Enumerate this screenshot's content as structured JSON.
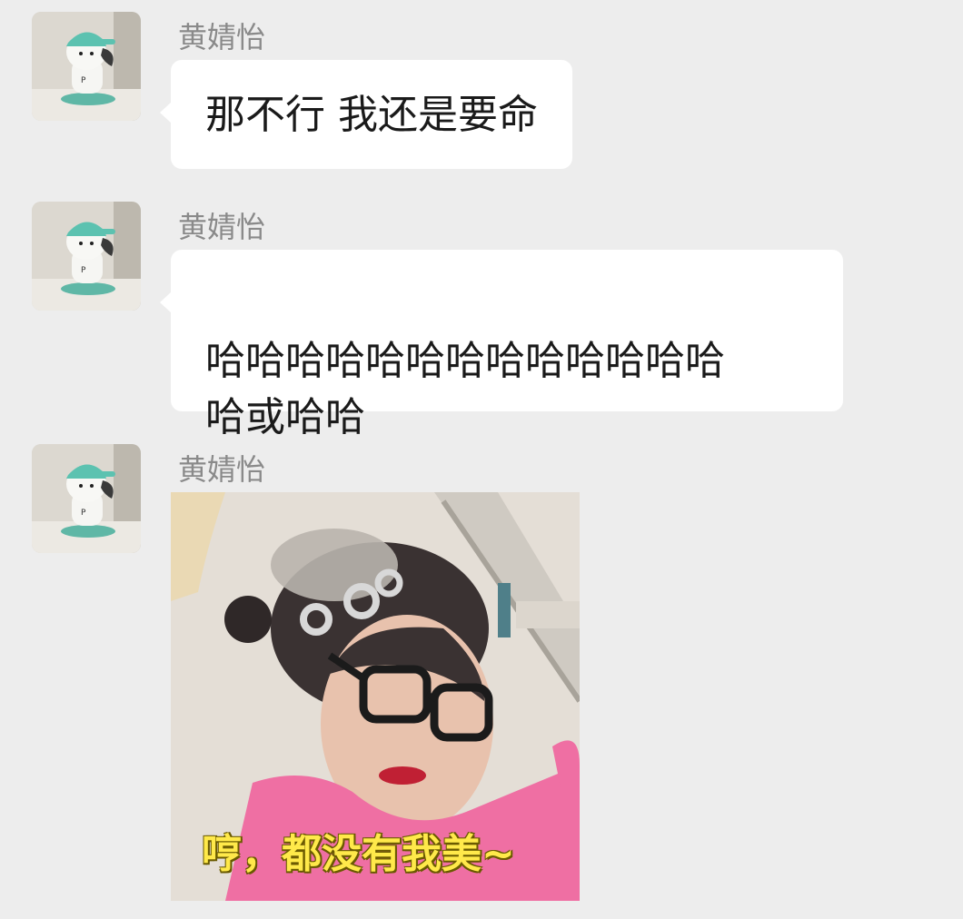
{
  "messages": [
    {
      "sender": "黄婧怡",
      "text": "那不行 我还是要命",
      "avatar_icon": "pochacco-avatar-icon"
    },
    {
      "sender": "黄婧怡",
      "text": "哈哈哈哈哈哈哈哈哈哈哈哈哈\n哈或哈哈",
      "avatar_icon": "pochacco-avatar-icon"
    },
    {
      "sender": "黄婧怡",
      "sticker_caption": "哼，都没有我美~",
      "avatar_icon": "pochacco-avatar-icon"
    }
  ],
  "colors": {
    "background": "#ededed",
    "bubble": "#ffffff",
    "sender_name": "#8a8a8a",
    "caption": "#ffe94a"
  }
}
